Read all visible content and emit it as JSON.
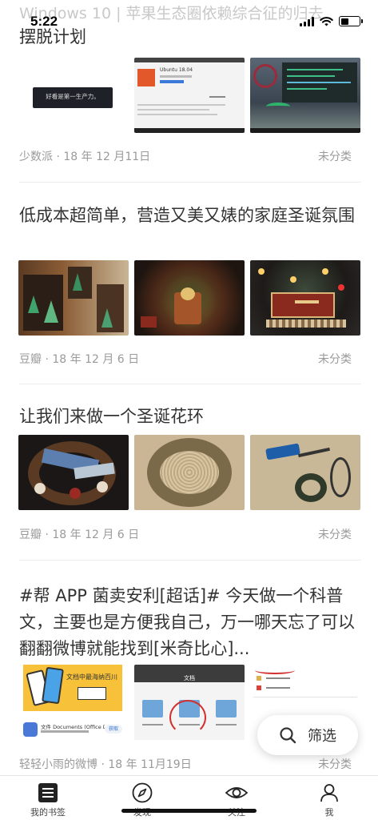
{
  "status_bar": {
    "time": "5:22",
    "behind_text": "Windows 10 | 苹果生态圈依赖综合征的归去"
  },
  "posts": [
    {
      "title": "摆脱计划",
      "thumb_caption": "好看是第一生产力。",
      "thumb_window_title": "Ubuntu 18.04",
      "source": "少数派 · 18 年 12 月11日",
      "category": "未分类"
    },
    {
      "title": "低成本超简单，营造又美又婊的家庭圣诞氛围",
      "source": "豆瓣 · 18 年 12 月 6 日",
      "category": "未分类"
    },
    {
      "title": "让我们来做一个圣诞花环",
      "source": "豆瓣 · 18 年 12 月 6 日",
      "category": "未分类"
    },
    {
      "title": "#帮 APP 菌卖安利[超话]# 今天做一个科普文，主要也是方便我自己，万一哪天忘了可以翻翻微博就能找到[米奇比心]...",
      "thumb_banner": "文档中最海纳百川",
      "thumb_app_name": "文件 Documents (Office D...",
      "thumb_app_button": "获取",
      "thumb_screen_title": "文档",
      "source": "轻轻小雨的微博 · 18 年 11月19日",
      "category": "未分类"
    }
  ],
  "filter_button": {
    "label": "筛选",
    "icon": "search-icon"
  },
  "tabbar": {
    "items": [
      {
        "label": "我的书签",
        "icon": "bookmark-list-icon"
      },
      {
        "label": "发现",
        "icon": "compass-icon"
      },
      {
        "label": "关注",
        "icon": "eye-icon"
      },
      {
        "label": "我",
        "icon": "user-icon"
      }
    ]
  },
  "colors": {
    "text": "#333333",
    "meta": "#9a9a9a",
    "divider": "#ececec"
  }
}
